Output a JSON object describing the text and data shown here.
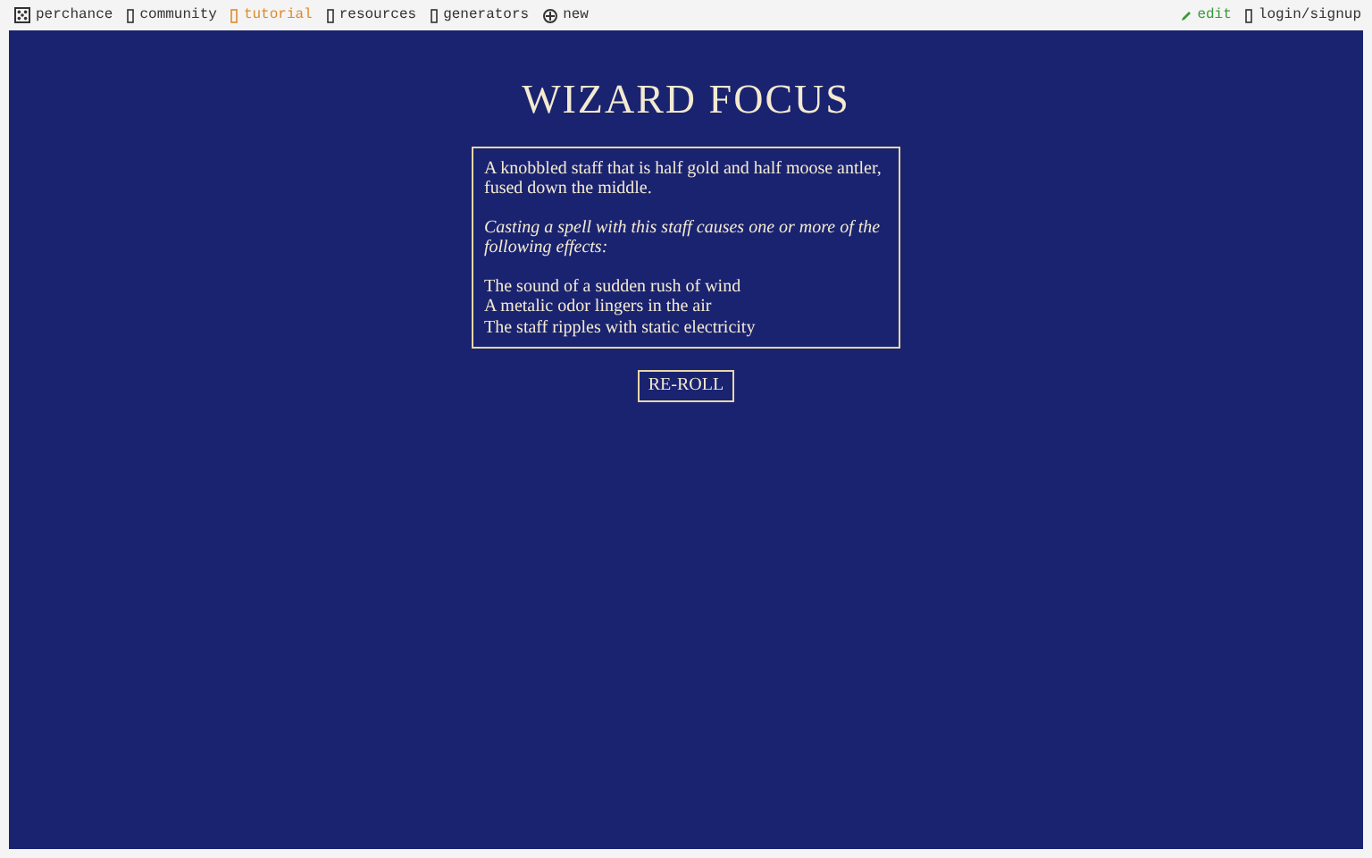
{
  "topbar": {
    "left": [
      {
        "label": "perchance",
        "kind": "dice"
      },
      {
        "label": "community",
        "kind": "box"
      },
      {
        "label": "tutorial",
        "kind": "box",
        "highlighted": true
      },
      {
        "label": "resources",
        "kind": "box"
      },
      {
        "label": "generators",
        "kind": "box"
      },
      {
        "label": "new",
        "kind": "plus"
      }
    ],
    "right": [
      {
        "label": "edit",
        "kind": "pencil"
      },
      {
        "label": "login/signup",
        "kind": "box"
      }
    ]
  },
  "title": "WIZARD FOCUS",
  "result": {
    "description": "A knobbled staff that is half gold and half moose antler, fused down the middle.",
    "intro": "Casting a spell with this staff causes one or more of the following effects:",
    "effects": [
      "The sound of a sudden rush of wind",
      "A metalic odor lingers in the air",
      "The staff ripples with static electricity"
    ]
  },
  "button": "RE-ROLL"
}
